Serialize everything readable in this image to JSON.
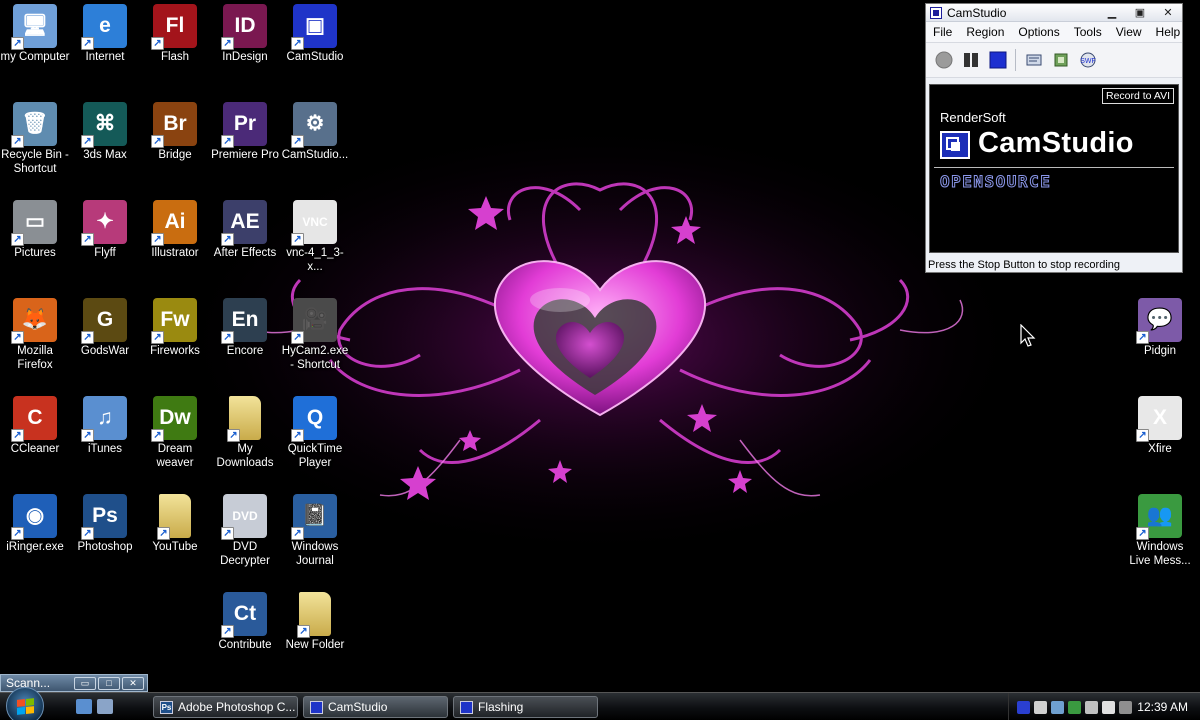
{
  "desktop": {
    "icons": [
      {
        "label": "my Computer",
        "icon": "computer-icon",
        "bg": "#6f9fd8",
        "glyph": "🖥"
      },
      {
        "label": "Internet",
        "icon": "internet-explorer-icon",
        "bg": "#2d7fd8",
        "glyph": "e"
      },
      {
        "label": "Flash",
        "icon": "flash-icon",
        "bg": "#a3141b",
        "glyph": "Fl"
      },
      {
        "label": "InDesign",
        "icon": "indesign-icon",
        "bg": "#7a1850",
        "glyph": "ID"
      },
      {
        "label": "CamStudio",
        "icon": "camstudio-icon",
        "bg": "#1f34c8",
        "glyph": "▣"
      },
      {
        "label": "Recycle Bin - Shortcut",
        "icon": "recycle-bin-icon",
        "bg": "#5f8cb0",
        "glyph": "🗑"
      },
      {
        "label": "3ds Max",
        "icon": "3ds-max-icon",
        "bg": "#145a58",
        "glyph": "⌘"
      },
      {
        "label": "Bridge",
        "icon": "bridge-icon",
        "bg": "#8a4310",
        "glyph": "Br"
      },
      {
        "label": "Premiere Pro",
        "icon": "premiere-pro-icon",
        "bg": "#4b2a78",
        "glyph": "Pr"
      },
      {
        "label": "CamStudio...",
        "icon": "camstudio-installer-icon",
        "bg": "#58708c",
        "glyph": "⚙"
      },
      {
        "label": "Pictures",
        "icon": "pictures-icon",
        "bg": "#8a8f94",
        "glyph": "▭"
      },
      {
        "label": "Flyff",
        "icon": "flyff-icon",
        "bg": "#b73a7a",
        "glyph": "✦"
      },
      {
        "label": "Illustrator",
        "icon": "illustrator-icon",
        "bg": "#c96d10",
        "glyph": "Ai"
      },
      {
        "label": "After Effects",
        "icon": "after-effects-icon",
        "bg": "#3c3f6a",
        "glyph": "AE"
      },
      {
        "label": "vnc-4_1_3-x...",
        "icon": "vnc-icon",
        "bg": "#e6e6e6",
        "glyph": "VNC"
      },
      {
        "label": "Mozilla Firefox",
        "icon": "firefox-icon",
        "bg": "#d9641a",
        "glyph": "🦊"
      },
      {
        "label": "GodsWar",
        "icon": "godswar-icon",
        "bg": "#5c4a12",
        "glyph": "G"
      },
      {
        "label": "Fireworks",
        "icon": "fireworks-icon",
        "bg": "#9a8a10",
        "glyph": "Fw"
      },
      {
        "label": "Encore",
        "icon": "encore-icon",
        "bg": "#2d3f50",
        "glyph": "En"
      },
      {
        "label": "HyCam2.exe - Shortcut",
        "icon": "hycam-icon",
        "bg": "#4a4a4a",
        "glyph": "🎥"
      },
      {
        "label": "CCleaner",
        "icon": "ccleaner-icon",
        "bg": "#c8321f",
        "glyph": "C"
      },
      {
        "label": "iTunes",
        "icon": "itunes-icon",
        "bg": "#5a8fd0",
        "glyph": "♫"
      },
      {
        "label": "Dream weaver",
        "icon": "dreamweaver-icon",
        "bg": "#3f7a12",
        "glyph": "Dw"
      },
      {
        "label": "My Downloads",
        "icon": "folder-icon",
        "bg": "#d6c36a",
        "glyph": ""
      },
      {
        "label": "QuickTime Player",
        "icon": "quicktime-icon",
        "bg": "#1f6fd8",
        "glyph": "Q"
      },
      {
        "label": "iRinger.exe",
        "icon": "iringer-icon",
        "bg": "#1f5fb8",
        "glyph": "◉"
      },
      {
        "label": "Photoshop",
        "icon": "photoshop-icon",
        "bg": "#1f4f8a",
        "glyph": "Ps"
      },
      {
        "label": "YouTube",
        "icon": "folder-icon",
        "bg": "#d6c36a",
        "glyph": ""
      },
      {
        "label": "DVD Decrypter",
        "icon": "dvd-decrypter-icon",
        "bg": "#c7ccd6",
        "glyph": "DVD"
      },
      {
        "label": "Windows Journal",
        "icon": "windows-journal-icon",
        "bg": "#2a5fa0",
        "glyph": "📓"
      },
      {
        "label": "Contribute",
        "icon": "contribute-icon",
        "bg": "#2a5a9a",
        "glyph": "Ct"
      },
      {
        "label": "New Folder",
        "icon": "folder-icon",
        "bg": "#d6c36a",
        "glyph": ""
      },
      {
        "label": "Pidgin",
        "icon": "pidgin-icon",
        "bg": "#7d5aa8",
        "glyph": "💬"
      },
      {
        "label": "Xfire",
        "icon": "xfire-icon",
        "bg": "#e8e8e8",
        "glyph": "X"
      },
      {
        "label": "Windows Live Mess...",
        "icon": "windows-live-messenger-icon",
        "bg": "#3a9a40",
        "glyph": "👥"
      }
    ]
  },
  "camstudio": {
    "title": "CamStudio",
    "menu": [
      "File",
      "Region",
      "Options",
      "Tools",
      "View",
      "Help"
    ],
    "record_label": "Record to AVI",
    "brand": "RenderSoft",
    "logo_text": "CamStudio",
    "open_source": "OPENSOURCE",
    "status": "Press the Stop Button to stop recording"
  },
  "minimized": {
    "title": "Scann..."
  },
  "taskbar": {
    "buttons": [
      {
        "label": "Adobe Photoshop C...",
        "icon": "photoshop-icon",
        "color": "#1f4f8a",
        "glyph": "Ps"
      },
      {
        "label": "CamStudio",
        "icon": "camstudio-icon",
        "color": "#1f34c8",
        "glyph": ""
      },
      {
        "label": "Flashing",
        "icon": "camstudio-icon",
        "color": "#1f34c8",
        "glyph": ""
      }
    ],
    "clock": "12:39 AM"
  },
  "colors": {
    "accent_pink": "#e23cd6",
    "camstudio_blue": "#1f34c8"
  }
}
